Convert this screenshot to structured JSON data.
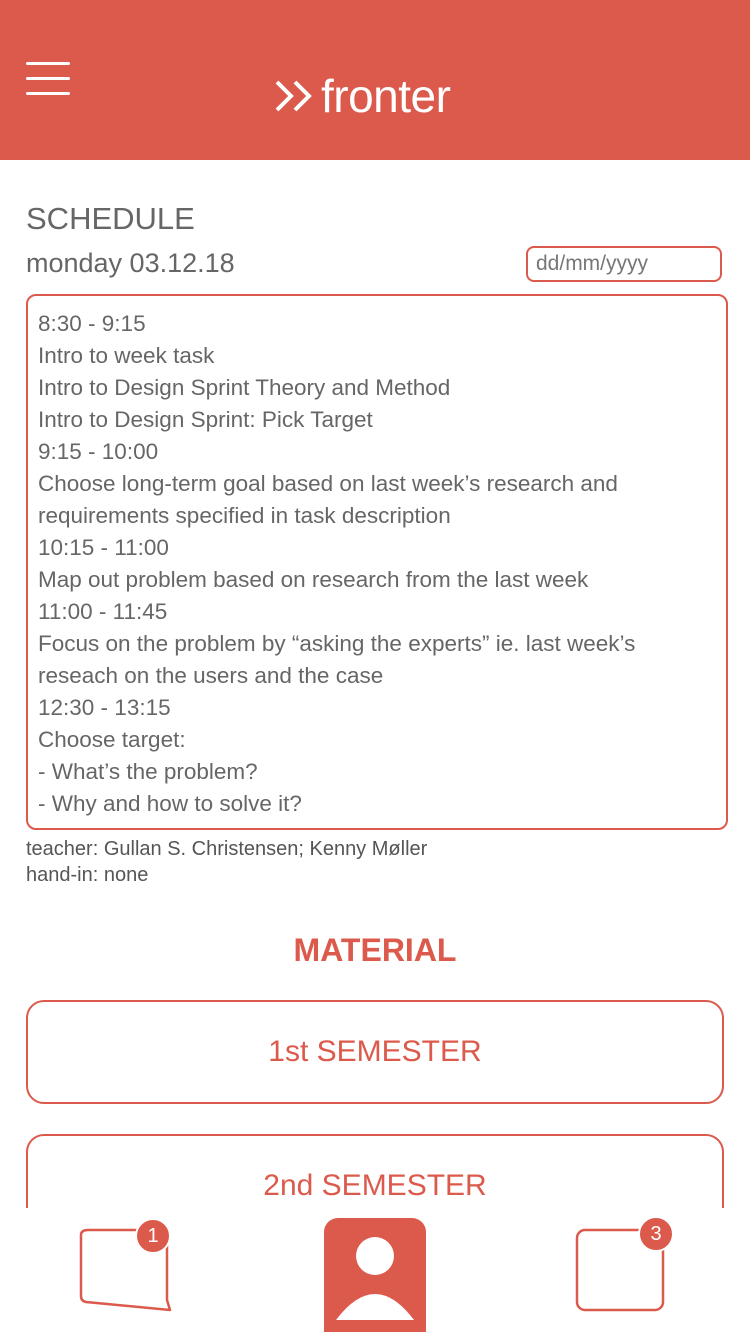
{
  "header": {
    "logo_text": "fronter",
    "brand_color": "#dc5a4c"
  },
  "schedule": {
    "title": "SCHEDULE",
    "date_label": "monday 03.12.18",
    "date_placeholder": "dd/mm/yyyy",
    "lines": [
      "8:30 - 9:15",
      "Intro to week task",
      "Intro to Design Sprint Theory and Method",
      "Intro to Design Sprint: Pick Target",
      "9:15 - 10:00",
      "Choose long-term goal based on last week’s research and",
      "requirements specified in task description",
      "10:15 - 11:00",
      "Map out problem based on research from the last week",
      "11:00 - 11:45",
      "Focus on the problem by “asking the experts” ie. last week’s",
      "reseach on the users and the case",
      "12:30 - 13:15",
      "Choose target:",
      "- What’s the problem?",
      "- Why and how to solve it?"
    ],
    "teacher": "teacher: Gullan S. Christensen; Kenny Møller",
    "hand_in": "hand-in: none"
  },
  "material": {
    "title": "MATERIAL",
    "semesters": [
      "1st SEMESTER",
      "2nd SEMESTER"
    ]
  },
  "bottom_nav": {
    "messages_badge": "1",
    "profile_icon": "user-icon",
    "notifications_badge": "3"
  }
}
